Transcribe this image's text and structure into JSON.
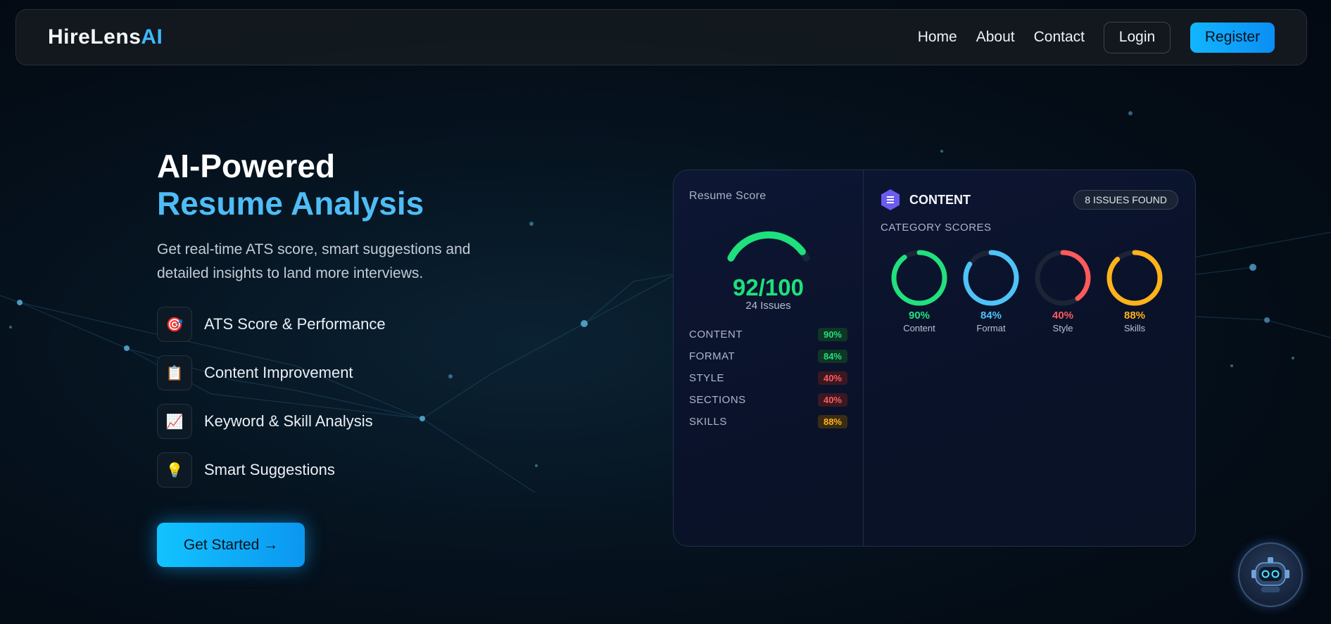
{
  "brand": {
    "name": "HireLens",
    "suffix": "AI"
  },
  "nav": {
    "links": [
      "Home",
      "About",
      "Contact"
    ],
    "login_label": "Login",
    "register_label": "Register"
  },
  "hero": {
    "title_line1": "AI-Powered",
    "title_line2": "Resume Analysis",
    "subtitle": "Get real-time ATS score, smart suggestions and detailed insights to land more interviews.",
    "features": [
      {
        "icon": "target-icon",
        "glyph": "🎯",
        "label": "ATS Score & Performance"
      },
      {
        "icon": "clipboard-icon",
        "glyph": "📋",
        "label": "Content Improvement"
      },
      {
        "icon": "chart-icon",
        "glyph": "📈",
        "label": "Keyword & Skill Analysis"
      },
      {
        "icon": "lightbulb-icon",
        "glyph": "💡",
        "label": "Smart Suggestions"
      }
    ],
    "cta_label": "Get Started →"
  },
  "dashboard": {
    "resume_score_label": "Resume Score",
    "score_text": "92/100",
    "score_value": 92,
    "issues_text": "24 Issues",
    "rows": [
      {
        "label": "CONTENT",
        "pct": "90%",
        "tone": "green"
      },
      {
        "label": "FORMAT",
        "pct": "84%",
        "tone": "green"
      },
      {
        "label": "STYLE",
        "pct": "40%",
        "tone": "red"
      },
      {
        "label": "SECTIONS",
        "pct": "40%",
        "tone": "red"
      },
      {
        "label": "SKILLS",
        "pct": "88%",
        "tone": "amber"
      }
    ],
    "section_title": "CONTENT",
    "issues_badge": "8 ISSUES FOUND",
    "category_label": "CATEGORY SCORES",
    "categories": [
      {
        "name": "Content",
        "pct_text": "90%",
        "value": 90,
        "color": "#22e07d"
      },
      {
        "name": "Format",
        "pct_text": "84%",
        "value": 84,
        "color": "#4fc3f7"
      },
      {
        "name": "Style",
        "pct_text": "40%",
        "value": 40,
        "color": "#ff5a5a"
      },
      {
        "name": "Skills",
        "pct_text": "88%",
        "value": 88,
        "color": "#ffb31a"
      }
    ]
  },
  "colors": {
    "accent": "#3fb8ff",
    "score_green": "#1ee07c"
  }
}
